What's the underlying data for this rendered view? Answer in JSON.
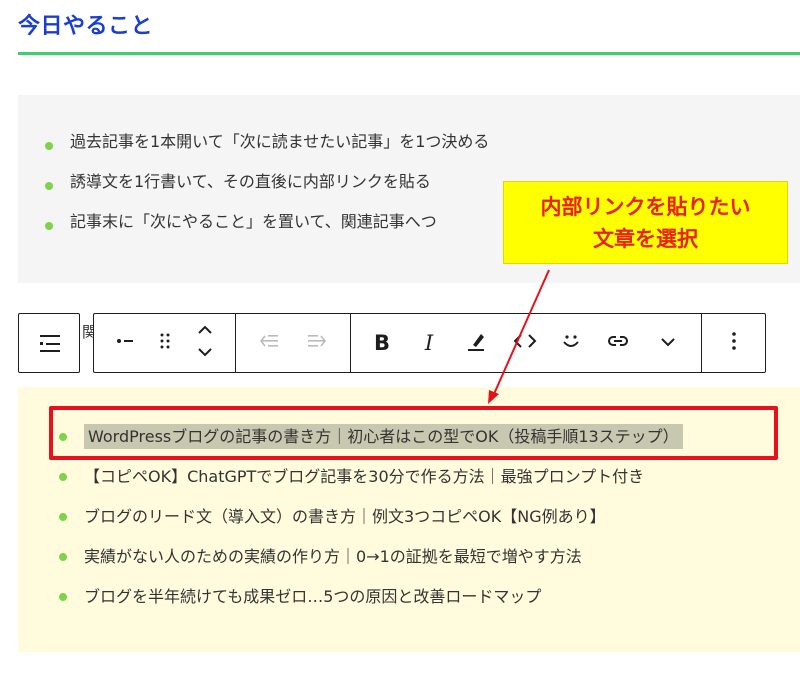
{
  "heading": "今日やること",
  "colors": {
    "heading": "#1a3fd0",
    "accent_line": "#3fcf6d",
    "bullet": "#7ed34b",
    "callout_bg": "#ffff00",
    "callout_text": "#e8221b",
    "selection_border": "#e8101a"
  },
  "top_list": [
    "過去記事を1本開いて「次に読ませたい記事」を1つ決める",
    "誘導文を1行書いて、その直後に内部リンクを貼る",
    "記事末に「次にやること」を置いて、関連記事へつ"
  ],
  "callout": {
    "line1": "内部リンクを貼りたい",
    "line2": "文章を選択"
  },
  "peek_char": "関",
  "toolbar": {
    "icons": [
      "list-view-icon",
      "bullet-list-icon",
      "drag-handle-icon",
      "move-up-down-icon",
      "outdent-icon",
      "indent-icon",
      "bold-icon",
      "italic-icon",
      "highlight-icon",
      "code-icon",
      "emoji-icon",
      "link-icon",
      "more-chevron-icon",
      "options-icon"
    ],
    "bold": "B",
    "italic": "I"
  },
  "bottom_list": [
    "WordPressブログの記事の書き方｜初心者はこの型でOK（投稿手順13ステップ）",
    "【コピペOK】ChatGPTでブログ記事を30分で作る方法｜最強プロンプト付き",
    "ブログのリード文（導入文）の書き方｜例文3つコピペOK【NG例あり】",
    "実績がない人のための実績の作り方｜0→1の証拠を最短で増やす方法",
    "ブログを半年続けても成果ゼロ…5つの原因と改善ロードマップ"
  ]
}
